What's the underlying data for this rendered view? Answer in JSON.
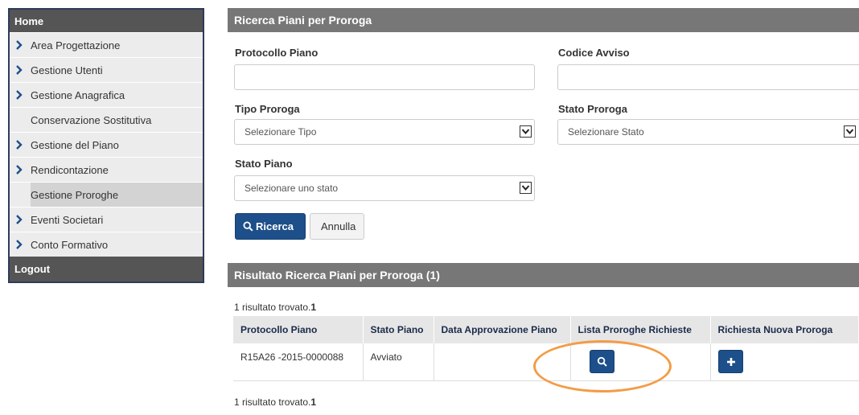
{
  "sidebar": {
    "home": "Home",
    "items": [
      {
        "label": "Area Progettazione",
        "chevron": true
      },
      {
        "label": "Gestione Utenti",
        "chevron": true
      },
      {
        "label": "Gestione Anagrafica",
        "chevron": true
      },
      {
        "label": "Conservazione Sostitutiva",
        "chevron": false
      },
      {
        "label": "Gestione del Piano",
        "chevron": true
      },
      {
        "label": "Rendicontazione",
        "chevron": true
      },
      {
        "label": "Gestione Proroghe",
        "chevron": false
      },
      {
        "label": "Eventi Societari",
        "chevron": true
      },
      {
        "label": "Conto Formativo",
        "chevron": true
      }
    ],
    "logout": "Logout"
  },
  "search": {
    "title": "Ricerca Piani per Proroga",
    "protocollo_label": "Protocollo Piano",
    "protocollo_value": "",
    "codice_label": "Codice Avviso",
    "codice_value": "",
    "tipo_label": "Tipo Proroga",
    "tipo_selected": "Selezionare Tipo",
    "stato_proroga_label": "Stato Proroga",
    "stato_proroga_selected": "Selezionare Stato",
    "stato_piano_label": "Stato Piano",
    "stato_piano_selected": "Selezionare uno stato",
    "search_button": "Ricerca",
    "cancel_button": "Annulla"
  },
  "results": {
    "title": "Risultato Ricerca Piani per Proroga (1)",
    "count_text": "1 risultato trovato.",
    "count_value": "1",
    "columns": [
      "Protocollo Piano",
      "Stato Piano",
      "Data Approvazione Piano",
      "Lista Proroghe Richieste",
      "Richiesta Nuova Proroga"
    ],
    "rows": [
      {
        "protocollo": "R15A26 -2015-0000088",
        "stato": "Avviato",
        "data": ""
      }
    ]
  },
  "colors": {
    "accent": "#1d4f8a",
    "header_grey": "#777777",
    "annotation": "#f39c47"
  }
}
